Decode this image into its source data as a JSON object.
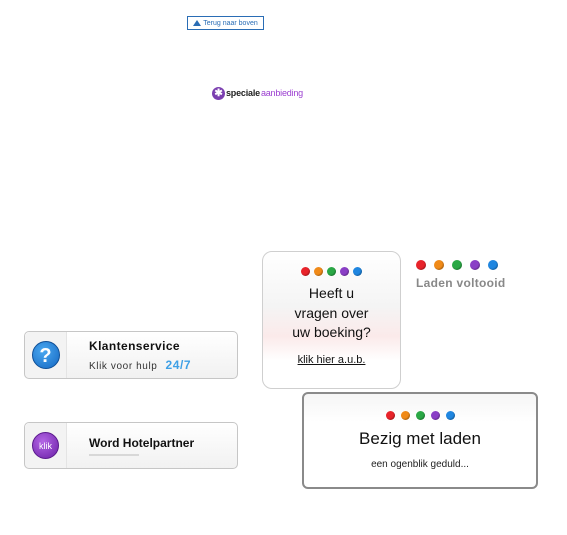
{
  "top_link": {
    "label": "Terug naar boven",
    "icon": "triangle-up-icon",
    "color": "#2a6db5"
  },
  "offer_logo": {
    "word1": "speciale",
    "word2": "aanbieding",
    "icon": "star-badge-icon",
    "accent": "#9b3fd0"
  },
  "dot_colors": [
    "#e8232a",
    "#f08a18",
    "#2aa845",
    "#8a3fc6",
    "#1f86e0"
  ],
  "help_popup": {
    "line1": "Heeft u",
    "line2": "vragen over",
    "line3": "uw boeking?",
    "link": "klik hier a.u.b."
  },
  "loading_done": {
    "label": "Laden voltooid"
  },
  "customer_service": {
    "title": "Klantenservice",
    "subtitle": "Klik voor hulp",
    "hours": "24/7",
    "icon": "question-icon"
  },
  "hotel_partner": {
    "badge": "klik",
    "title": "Word Hotelpartner"
  },
  "loading_box": {
    "title": "Bezig met laden",
    "subtitle": "een ogenblik geduld..."
  }
}
